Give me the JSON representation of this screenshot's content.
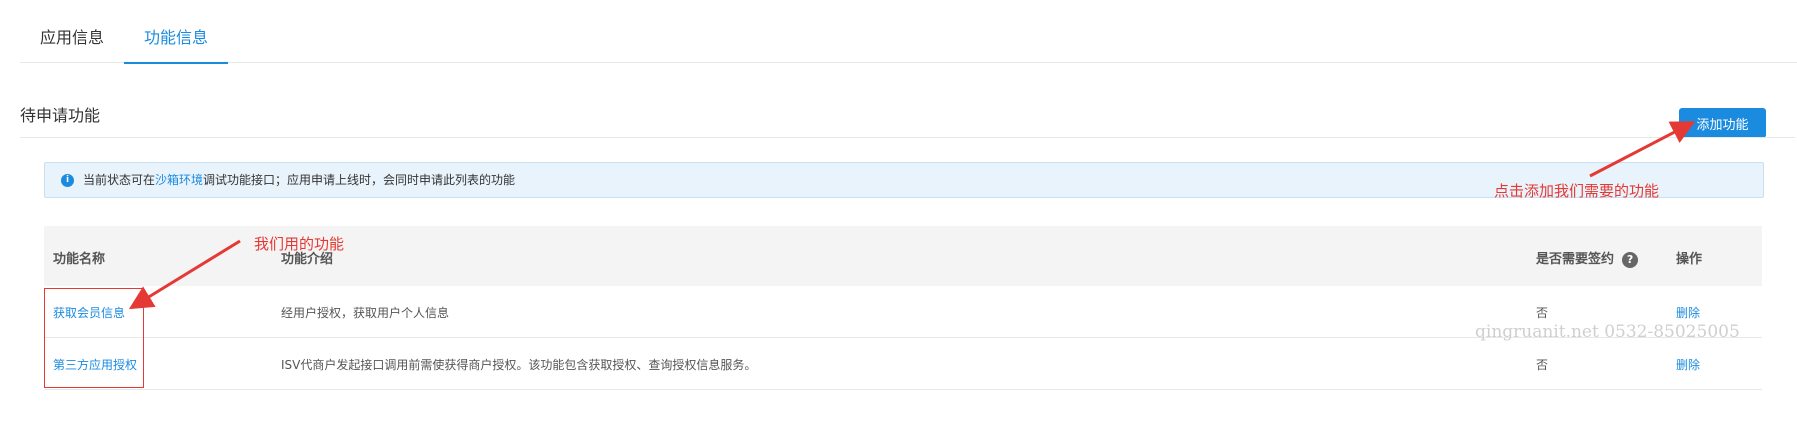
{
  "tabs": [
    "应用信息",
    "功能信息"
  ],
  "section_title": "待申请功能",
  "add_button": "添加功能",
  "notice": {
    "before": "当前状态可在",
    "link": "沙箱环境",
    "after": "调试功能接口；应用申请上线时，会同时申请此列表的功能"
  },
  "table": {
    "headers": [
      "功能名称",
      "功能介绍",
      "是否需要签约",
      "操作"
    ],
    "rows": [
      {
        "name": "获取会员信息",
        "desc": "经用户授权，获取用户个人信息",
        "sign": "否",
        "action": "删除"
      },
      {
        "name": "第三方应用授权",
        "desc": "ISV代商户发起接口调用前需使获得商户授权。该功能包含获取授权、查询授权信息服务。",
        "sign": "否",
        "action": "删除"
      }
    ]
  },
  "annotations": {
    "left": "我们用的功能",
    "right": "点击添加我们需要的功能"
  },
  "watermark": "qingruanit.net 0532-85025005",
  "colors": {
    "accent": "#1b8be0",
    "annotation": "#e53935"
  }
}
